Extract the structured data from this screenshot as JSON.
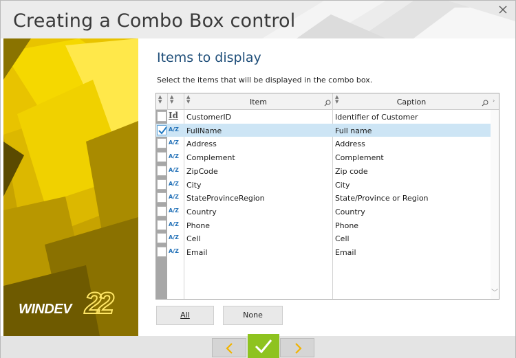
{
  "window": {
    "title": "Creating a Combo Box control",
    "close_icon": "close-icon"
  },
  "brand": {
    "logo_text": "WINDEV",
    "version": "22",
    "accent": "#f2cd00"
  },
  "main": {
    "heading": "Items to display",
    "instructions": "Select the items that will be displayed in the combo box."
  },
  "table": {
    "headers": {
      "item": "Item",
      "caption": "Caption"
    },
    "rows": [
      {
        "checked": false,
        "type": "Id",
        "item": "CustomerID",
        "caption": "Identifier of Customer"
      },
      {
        "checked": true,
        "type": "A/Z",
        "item": "FullName",
        "caption": "Full name"
      },
      {
        "checked": false,
        "type": "A/Z",
        "item": "Address",
        "caption": "Address"
      },
      {
        "checked": false,
        "type": "A/Z",
        "item": "Complement",
        "caption": "Complement"
      },
      {
        "checked": false,
        "type": "A/Z",
        "item": "ZipCode",
        "caption": "Zip code"
      },
      {
        "checked": false,
        "type": "A/Z",
        "item": "City",
        "caption": "City"
      },
      {
        "checked": false,
        "type": "A/Z",
        "item": "StateProvinceRegion",
        "caption": "State/Province or Region"
      },
      {
        "checked": false,
        "type": "A/Z",
        "item": "Country",
        "caption": "Country"
      },
      {
        "checked": false,
        "type": "A/Z",
        "item": "Phone",
        "caption": "Phone"
      },
      {
        "checked": false,
        "type": "A/Z",
        "item": "Cell",
        "caption": "Cell"
      },
      {
        "checked": false,
        "type": "A/Z",
        "item": "Email",
        "caption": "Email"
      }
    ],
    "selected_color": "#cde5f5"
  },
  "buttons": {
    "all": "All",
    "none": "None"
  },
  "footer": {
    "prev_icon": "chevron-left-icon",
    "finish_icon": "checkmark-icon",
    "next_icon": "chevron-right-icon",
    "finish_color": "#8ec31f",
    "nav_arrow_color": "#f2b400"
  }
}
